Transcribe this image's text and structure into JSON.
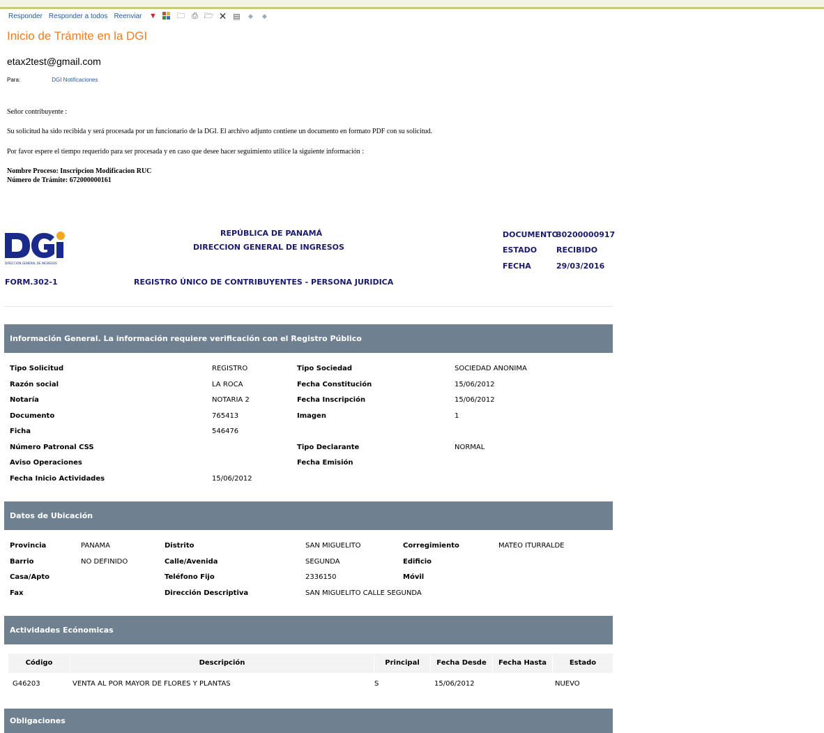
{
  "toolbar": {
    "reply": "Responder",
    "reply_all": "Responder a todos",
    "forward": "Reenviar"
  },
  "email": {
    "subject": "Inicio de Trámite en la DGI",
    "sender": "etax2test@gmail.com",
    "to_label": "Para:",
    "to_value": "DGI Notificaciones",
    "greeting": "Señor contribuyente :",
    "para1": "Su solicitud ha sido recibida y será procesada por un funcionario de la DGI. El archivo adjunto contiene un documento en formato PDF con su solicitud.",
    "para2": "Por favor espere el tiempo requerido para ser procesada y en caso que desee hacer seguimiento utilice la siguiente información :",
    "proceso": "Nombre Proceso: Inscripcion Modificacion RUC",
    "tramite": "Número de Trámite: 672000000161"
  },
  "form_header": {
    "country": "REPÚBLICA DE PANAMÁ",
    "agency": "DIRECCION GENERAL DE INGRESOS",
    "form_code": "FORM.302-1",
    "form_title": "REGISTRO ÚNICO DE CONTRIBUYENTES - PERSONA JURIDICA",
    "documento_label": "DOCUMENTO",
    "documento_value": "30200000917",
    "estado_label": "ESTADO",
    "estado_value": "RECIBIDO",
    "fecha_label": "FECHA",
    "fecha_value": "29/03/2016",
    "logo_text": "DGi",
    "logo_subtext": "DIRECCIÓN GENERAL DE INGRESOS"
  },
  "general": {
    "title": "Información General. La información requiere verificación con el Registro Público",
    "left": [
      {
        "label": "Tipo Solicitud",
        "value": "REGISTRO"
      },
      {
        "label": "Razón social",
        "value": "LA ROCA"
      },
      {
        "label": "Notaría",
        "value": "NOTARIA 2"
      },
      {
        "label": "Documento",
        "value": "765413"
      },
      {
        "label": "Ficha",
        "value": "546476"
      },
      {
        "label": "Número Patronal CSS",
        "value": ""
      },
      {
        "label": "Aviso Operaciones",
        "value": ""
      },
      {
        "label": "Fecha Inicio Actividades",
        "value": "15/06/2012"
      }
    ],
    "right": [
      {
        "label": "Tipo Sociedad",
        "value": "SOCIEDAD ANONIMA"
      },
      {
        "label": "Fecha Constitución",
        "value": "15/06/2012"
      },
      {
        "label": "Fecha Inscripción",
        "value": "15/06/2012"
      },
      {
        "label": "Imagen",
        "value": "1"
      },
      {
        "label": "",
        "value": ""
      },
      {
        "label": "Tipo Declarante",
        "value": "NORMAL"
      },
      {
        "label": "Fecha Emisión",
        "value": ""
      }
    ]
  },
  "ubicacion": {
    "title": "Datos de Ubicación",
    "rows": [
      {
        "l1": "Provincia",
        "v1": "PANAMA",
        "l2": "Distrito",
        "v2": "SAN MIGUELITO",
        "l3": "Corregimiento",
        "v3": "MATEO ITURRALDE"
      },
      {
        "l1": "Barrio",
        "v1": "NO DEFINIDO",
        "l2": "Calle/Avenida",
        "v2": "SEGUNDA",
        "l3": "Edificio",
        "v3": ""
      },
      {
        "l1": "Casa/Apto",
        "v1": "",
        "l2": "Teléfono Fijo",
        "v2": "2336150",
        "l3": "Móvil",
        "v3": ""
      },
      {
        "l1": "Fax",
        "v1": "",
        "l2": "Dirección Descriptiva",
        "v2": "SAN MIGUELITO CALLE SEGUNDA",
        "l3": "",
        "v3": ""
      }
    ]
  },
  "actividades": {
    "title": "Actividades Ecónomicas",
    "headers": [
      "Código",
      "Descripción",
      "Principal",
      "Fecha Desde",
      "Fecha Hasta",
      "Estado"
    ],
    "rows": [
      {
        "codigo": "G46203",
        "descripcion": "VENTA AL POR MAYOR DE FLORES Y PLANTAS",
        "principal": "S",
        "desde": "15/06/2012",
        "hasta": "",
        "estado": "NUEVO"
      }
    ]
  },
  "obligaciones": {
    "title": "Obligaciones"
  },
  "colors": {
    "section_bg": "#6f8090",
    "subject": "#f47b20",
    "link": "#1f5aa6",
    "form_header": "#1a1a6e"
  }
}
